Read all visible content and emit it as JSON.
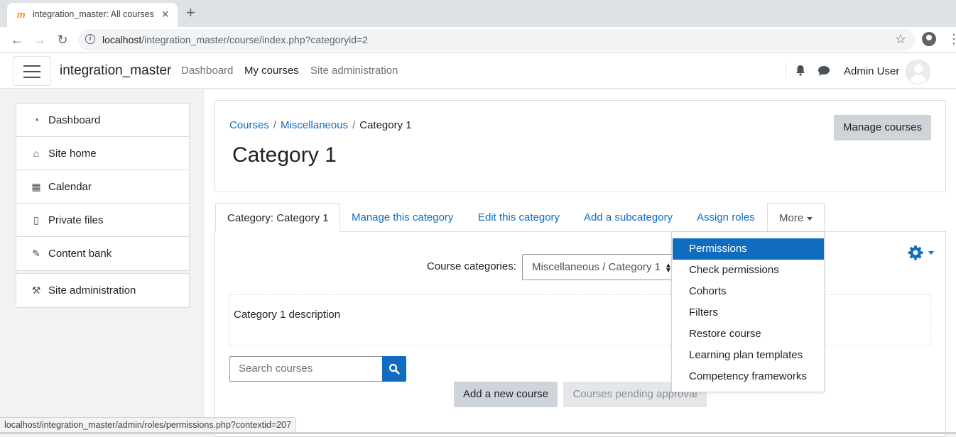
{
  "browser": {
    "tab_title": "integration_master: All courses",
    "url_host": "localhost",
    "url_path": "/integration_master/course/index.php?categoryid=2"
  },
  "navbar": {
    "site_name": "integration_master",
    "links": [
      "Dashboard",
      "My courses",
      "Site administration"
    ],
    "user_name": "Admin User"
  },
  "sidebar": {
    "items": [
      {
        "label": "Dashboard",
        "icon": "dashboard-icon"
      },
      {
        "label": "Site home",
        "icon": "home-icon"
      },
      {
        "label": "Calendar",
        "icon": "calendar-icon"
      },
      {
        "label": "Private files",
        "icon": "file-icon"
      },
      {
        "label": "Content bank",
        "icon": "brush-icon"
      }
    ],
    "admin": {
      "label": "Site administration",
      "icon": "wrench-icon"
    }
  },
  "header": {
    "breadcrumb": [
      "Courses",
      "Miscellaneous",
      "Category 1"
    ],
    "title": "Category 1",
    "manage_button": "Manage courses"
  },
  "tabs": {
    "active": "Category: Category 1",
    "links": [
      "Manage this category",
      "Edit this category",
      "Add a subcategory",
      "Assign roles"
    ],
    "more": "More"
  },
  "content": {
    "course_categories_label": "Course categories:",
    "category_select_value": "Miscellaneous / Category 1",
    "description": "Category 1 description",
    "search_placeholder": "Search courses",
    "add_course": "Add a new course",
    "pending": "Courses pending approval"
  },
  "more_menu": {
    "items": [
      "Permissions",
      "Check permissions",
      "Cohorts",
      "Filters",
      "Restore course",
      "Learning plan templates",
      "Competency frameworks"
    ],
    "active_index": 0
  },
  "status_url": "localhost/integration_master/admin/roles/permissions.php?contextid=207",
  "colors": {
    "accent": "#0f6cbf",
    "moodle_orange": "#f98012"
  }
}
